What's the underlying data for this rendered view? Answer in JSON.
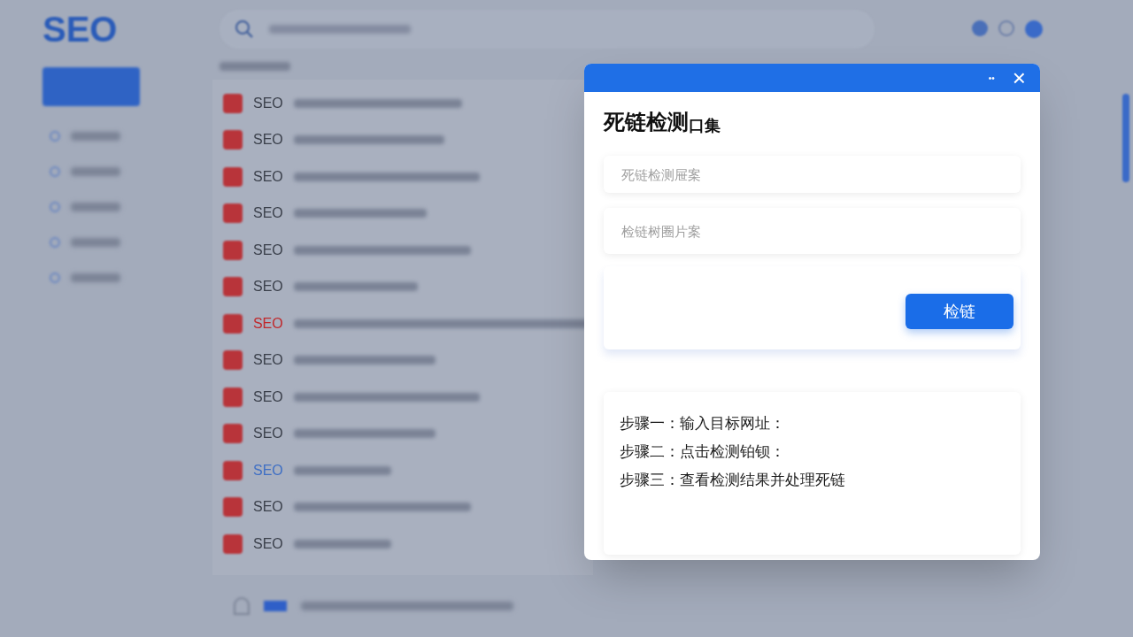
{
  "background": {
    "logo": "SEO",
    "rows": [
      {
        "prefix": "SEO",
        "color": "#3a3f4a"
      },
      {
        "prefix": "SEO",
        "color": "#3a3f4a"
      },
      {
        "prefix": "SEO",
        "color": "#3a3f4a"
      },
      {
        "prefix": "SEO",
        "color": "#3a3f4a"
      },
      {
        "prefix": "SEO",
        "color": "#3a3f4a"
      },
      {
        "prefix": "SEO",
        "color": "#3a3f4a"
      },
      {
        "prefix": "SEO",
        "color": "#c0282b"
      },
      {
        "prefix": "SEO",
        "color": "#3a3f4a"
      },
      {
        "prefix": "SEO",
        "color": "#3a3f4a"
      },
      {
        "prefix": "SEO",
        "color": "#3a3f4a"
      },
      {
        "prefix": "SEO",
        "color": "#3f6fc4"
      },
      {
        "prefix": "SEO",
        "color": "#3a3f4a"
      },
      {
        "prefix": "SEO",
        "color": "#3a3f4a"
      }
    ]
  },
  "dialog": {
    "title_bar": {
      "minimize": "••",
      "close": "×"
    },
    "title": "死链检测",
    "title_suffix": "口集",
    "fields": [
      {
        "placeholder": "死链检测屉案"
      },
      {
        "placeholder": "检链树圈片案"
      }
    ],
    "button": "检链",
    "steps": [
      "步骤一：输入目标网址：",
      "步骤二：点击检测铂钡：",
      "步骤三：查看检测结果并处理死链"
    ]
  }
}
